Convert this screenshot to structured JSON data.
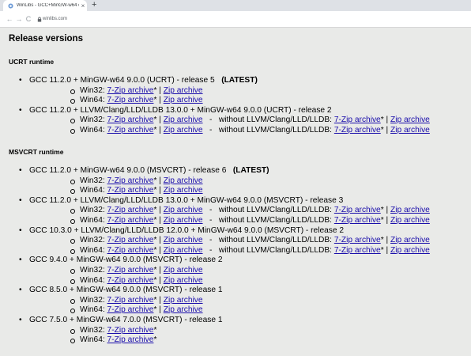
{
  "browser": {
    "tab_title": "WinLibs - GCC+MinGW-w64 com",
    "tab_close": "×",
    "new_tab": "+",
    "url": "winlibs.com",
    "back": "←",
    "forward": "→",
    "reload": "C"
  },
  "page": {
    "heading": "Release versions",
    "sections": [
      {
        "title": "UCRT runtime",
        "releases": [
          {
            "text": "GCC 11.2.0 + MinGW-w64 9.0.0 (UCRT) - release 5",
            "badge": "(LATEST)",
            "rows": [
              {
                "arch": "Win32:",
                "links": [
                  "7-Zip archive",
                  "Zip archive"
                ],
                "alt": null
              },
              {
                "arch": "Win64:",
                "links": [
                  "7-Zip archive",
                  "Zip archive"
                ],
                "alt": null
              }
            ]
          },
          {
            "text": "GCC 11.2.0 + LLVM/Clang/LLD/LLDB 13.0.0 + MinGW-w64 9.0.0 (UCRT) - release 2",
            "badge": "",
            "rows": [
              {
                "arch": "Win32:",
                "links": [
                  "7-Zip archive",
                  "Zip archive"
                ],
                "alt": {
                  "label": "without LLVM/Clang/LLD/LLDB:",
                  "links": [
                    "7-Zip archive",
                    "Zip archive"
                  ]
                }
              },
              {
                "arch": "Win64:",
                "links": [
                  "7-Zip archive",
                  "Zip archive"
                ],
                "alt": {
                  "label": "without LLVM/Clang/LLD/LLDB:",
                  "links": [
                    "7-Zip archive",
                    "Zip archive"
                  ]
                }
              }
            ]
          }
        ]
      },
      {
        "title": "MSVCRT runtime",
        "releases": [
          {
            "text": "GCC 11.2.0 + MinGW-w64 9.0.0 (MSVCRT) - release 6",
            "badge": "(LATEST)",
            "rows": [
              {
                "arch": "Win32:",
                "links": [
                  "7-Zip archive",
                  "Zip archive"
                ],
                "alt": null
              },
              {
                "arch": "Win64:",
                "links": [
                  "7-Zip archive",
                  "Zip archive"
                ],
                "alt": null
              }
            ]
          },
          {
            "text": "GCC 11.2.0 + LLVM/Clang/LLD/LLDB 13.0.0 + MinGW-w64 9.0.0 (MSVCRT) - release 3",
            "badge": "",
            "rows": [
              {
                "arch": "Win32:",
                "links": [
                  "7-Zip archive",
                  "Zip archive"
                ],
                "alt": {
                  "label": "without LLVM/Clang/LLD/LLDB:",
                  "links": [
                    "7-Zip archive",
                    "Zip archive"
                  ]
                }
              },
              {
                "arch": "Win64:",
                "links": [
                  "7-Zip archive",
                  "Zip archive"
                ],
                "alt": {
                  "label": "without LLVM/Clang/LLD/LLDB:",
                  "links": [
                    "7-Zip archive",
                    "Zip archive"
                  ]
                }
              }
            ]
          },
          {
            "text": "GCC 10.3.0 + LLVM/Clang/LLD/LLDB 12.0.0 + MinGW-w64 9.0.0 (MSVCRT) - release 2",
            "badge": "",
            "rows": [
              {
                "arch": "Win32:",
                "links": [
                  "7-Zip archive",
                  "Zip archive"
                ],
                "alt": {
                  "label": "without LLVM/Clang/LLD/LLDB:",
                  "links": [
                    "7-Zip archive",
                    "Zip archive"
                  ]
                }
              },
              {
                "arch": "Win64:",
                "links": [
                  "7-Zip archive",
                  "Zip archive"
                ],
                "alt": {
                  "label": "without LLVM/Clang/LLD/LLDB:",
                  "links": [
                    "7-Zip archive",
                    "Zip archive"
                  ]
                }
              }
            ]
          },
          {
            "text": "GCC 9.4.0 + MinGW-w64 9.0.0 (MSVCRT) - release 2",
            "badge": "",
            "rows": [
              {
                "arch": "Win32:",
                "links": [
                  "7-Zip archive",
                  "Zip archive"
                ],
                "alt": null
              },
              {
                "arch": "Win64:",
                "links": [
                  "7-Zip archive",
                  "Zip archive"
                ],
                "alt": null
              }
            ]
          },
          {
            "text": "GCC 8.5.0 + MinGW-w64 9.0.0 (MSVCRT) - release 1",
            "badge": "",
            "rows": [
              {
                "arch": "Win32:",
                "links": [
                  "7-Zip archive",
                  "Zip archive"
                ],
                "alt": null
              },
              {
                "arch": "Win64:",
                "links": [
                  "7-Zip archive",
                  "Zip archive"
                ],
                "alt": null
              }
            ]
          },
          {
            "text": "GCC 7.5.0 + MinGW-w64 7.0.0 (MSVCRT) - release 1",
            "badge": "",
            "rows": [
              {
                "arch": "Win32:",
                "links": [
                  "7-Zip archive"
                ],
                "alt": null
              },
              {
                "arch": "Win64:",
                "links": [
                  "7-Zip archive"
                ],
                "alt": null
              }
            ]
          }
        ]
      }
    ],
    "asterisk": "*",
    "separator": "|",
    "dash": "-"
  }
}
